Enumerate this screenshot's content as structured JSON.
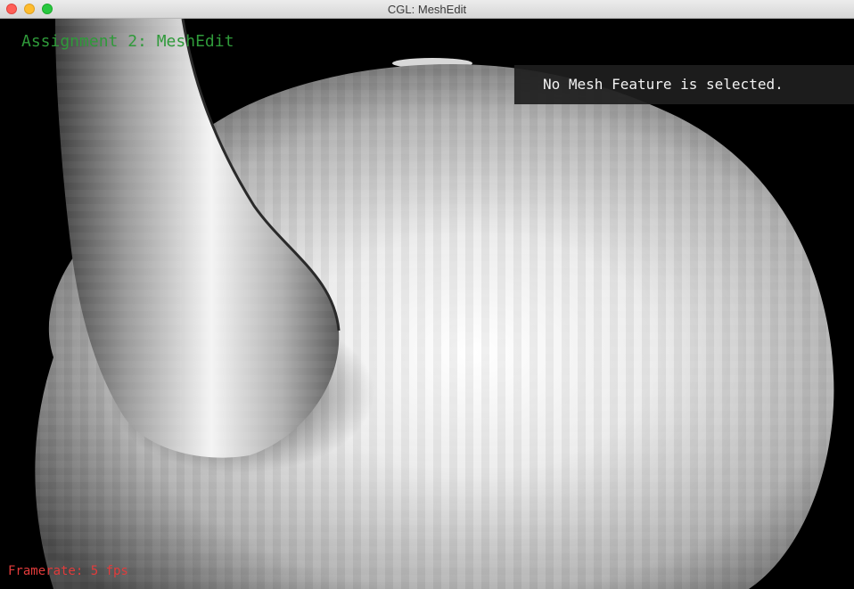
{
  "window": {
    "title": "CGL: MeshEdit",
    "buttons": [
      "close",
      "minimize",
      "zoom"
    ]
  },
  "hud": {
    "title": "Assignment 2: MeshEdit",
    "title_color": "#2f9a3a",
    "info_text": "No Mesh Feature is selected.",
    "framerate_text": "Framerate: 5 fps",
    "framerate_color": "#e23b3b"
  },
  "scene": {
    "model": "teapot-mesh",
    "shading": "flat-grayscale",
    "background": "#000000"
  }
}
